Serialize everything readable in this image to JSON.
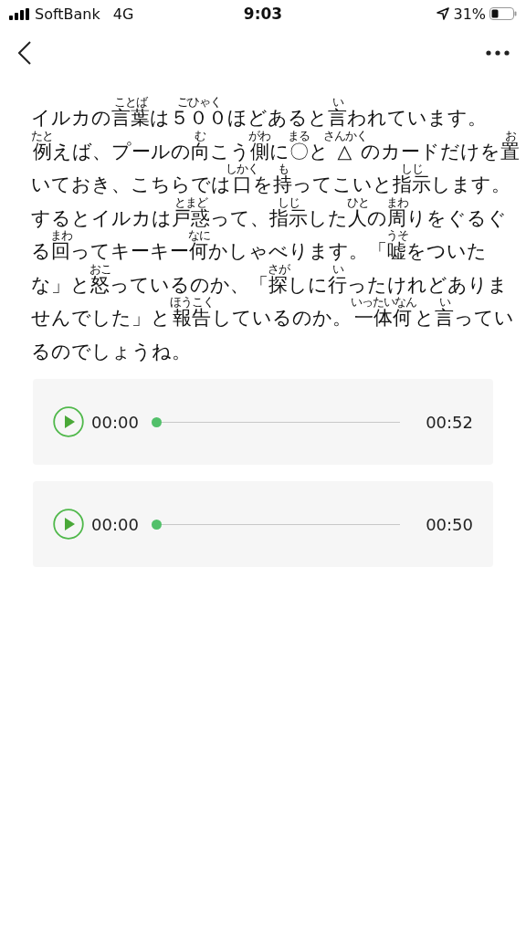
{
  "status_bar": {
    "carrier": "SoftBank",
    "network": "4G",
    "time": "9:03",
    "battery": "31%"
  },
  "paragraph_lines": [
    [
      {
        "text": "イルカの"
      },
      {
        "text": "言葉",
        "ruby": "ことば"
      },
      {
        "text": "は"
      },
      {
        "text": "５００",
        "ruby": "ごひゃく"
      },
      {
        "text": "ほどあると"
      },
      {
        "text": "言",
        "ruby": "い"
      },
      {
        "text": "われています。"
      }
    ],
    [
      {
        "text": "例",
        "ruby": "たと"
      },
      {
        "text": "えば、プールの"
      },
      {
        "text": "向",
        "ruby": "む"
      },
      {
        "text": "こう"
      },
      {
        "text": "側",
        "ruby": "がわ"
      },
      {
        "text": "に"
      },
      {
        "text": "〇",
        "ruby": "まる"
      },
      {
        "text": "と"
      },
      {
        "text": "△",
        "ruby": "さんかく"
      },
      {
        "text": "のカードだけを"
      },
      {
        "text": "置",
        "ruby": "お"
      }
    ],
    [
      {
        "text": "いておき、こちらでは"
      },
      {
        "text": "口",
        "ruby": "しかく"
      },
      {
        "text": "を"
      },
      {
        "text": "持",
        "ruby": "も"
      },
      {
        "text": "ってこいと"
      },
      {
        "text": "指示",
        "ruby": "しじ"
      },
      {
        "text": "します。"
      }
    ],
    [
      {
        "text": "するとイルカは"
      },
      {
        "text": "戸惑",
        "ruby": "とまど"
      },
      {
        "text": "って、"
      },
      {
        "text": "指示",
        "ruby": "しじ"
      },
      {
        "text": "した"
      },
      {
        "text": "人",
        "ruby": "ひと"
      },
      {
        "text": "の"
      },
      {
        "text": "周",
        "ruby": "まわ"
      },
      {
        "text": "りをぐるぐ"
      }
    ],
    [
      {
        "text": "る"
      },
      {
        "text": "回",
        "ruby": "まわ"
      },
      {
        "text": "ってキーキー"
      },
      {
        "text": "何",
        "ruby": "なに"
      },
      {
        "text": "かしゃべります。「"
      },
      {
        "text": "嘘",
        "ruby": "うそ"
      },
      {
        "text": "をついた"
      }
    ],
    [
      {
        "text": "な」と"
      },
      {
        "text": "怒",
        "ruby": "おこ"
      },
      {
        "text": "っているのか、「"
      },
      {
        "text": "探",
        "ruby": "さが"
      },
      {
        "text": "しに"
      },
      {
        "text": "行",
        "ruby": "い"
      },
      {
        "text": "ったけれどありま"
      }
    ],
    [
      {
        "text": "せんでした」と"
      },
      {
        "text": "報告",
        "ruby": "ほうこく"
      },
      {
        "text": "しているのか。"
      },
      {
        "text": "一体何",
        "ruby": "いったいなん"
      },
      {
        "text": "と"
      },
      {
        "text": "言",
        "ruby": "い"
      },
      {
        "text": "ってい"
      }
    ],
    [
      {
        "text": "るのでしょうね。"
      }
    ]
  ],
  "players": [
    {
      "current": "00:00",
      "duration": "00:52",
      "level": 0
    },
    {
      "current": "00:00",
      "duration": "00:50",
      "level": 0
    }
  ]
}
